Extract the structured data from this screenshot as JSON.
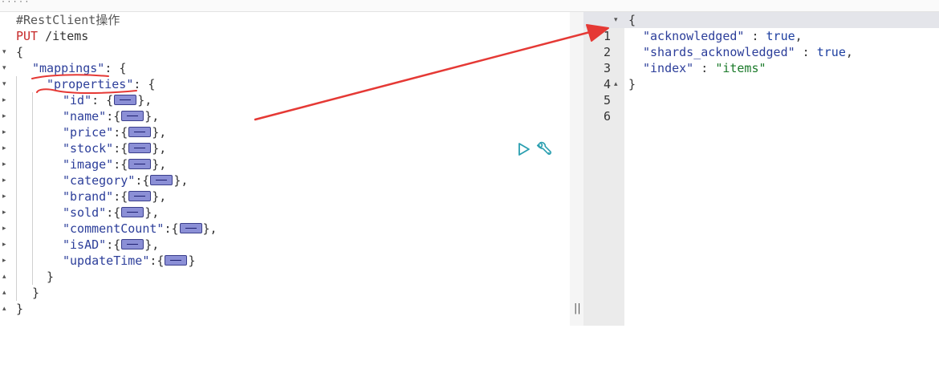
{
  "top_strip_text": "· ·  · · ·",
  "request": {
    "comment": "#RestClient操作",
    "method": "PUT",
    "path": "/items",
    "open_brace": "{",
    "mappings_key": "\"mappings\"",
    "properties_key": "\"properties\"",
    "fields": [
      {
        "key": "\"id\"",
        "sep": ": {",
        "end": "},"
      },
      {
        "key": "\"name\"",
        "sep": ":{",
        "end": "},"
      },
      {
        "key": "\"price\"",
        "sep": ":{",
        "end": "},"
      },
      {
        "key": "\"stock\"",
        "sep": ":{",
        "end": "},"
      },
      {
        "key": "\"image\"",
        "sep": ":{",
        "end": "},"
      },
      {
        "key": "\"category\"",
        "sep": ":{",
        "end": "},"
      },
      {
        "key": "\"brand\"",
        "sep": ":{",
        "end": "},"
      },
      {
        "key": "\"sold\"",
        "sep": ":{",
        "end": "},"
      },
      {
        "key": "\"commentCount\"",
        "sep": ":{",
        "end": "},"
      },
      {
        "key": "\"isAD\"",
        "sep": ":{",
        "end": "},"
      },
      {
        "key": "\"updateTime\"",
        "sep": ":{",
        "end": "}"
      }
    ],
    "close_properties": "}",
    "close_mappings": "}",
    "close_root": "}"
  },
  "response": {
    "line_numbers": [
      "1",
      "2",
      "3",
      "4",
      "5",
      "6"
    ],
    "open": "{",
    "acknowledged_key": "\"acknowledged\"",
    "acknowledged_value": "true",
    "shards_key": "\"shards_acknowledged\"",
    "shards_value": "true",
    "index_key": "\"index\"",
    "index_value": "\"items\"",
    "close": "}"
  },
  "toolbar": {
    "run_icon": "play-triangle-icon",
    "settings_icon": "wrench-icon"
  },
  "splitter_grip": "||",
  "colors": {
    "key_blue": "#2c3e9a",
    "method_red": "#c62828",
    "string_green": "#1b7a2a",
    "arrow_red": "#e53935",
    "icon_teal": "#2a9fb0"
  }
}
